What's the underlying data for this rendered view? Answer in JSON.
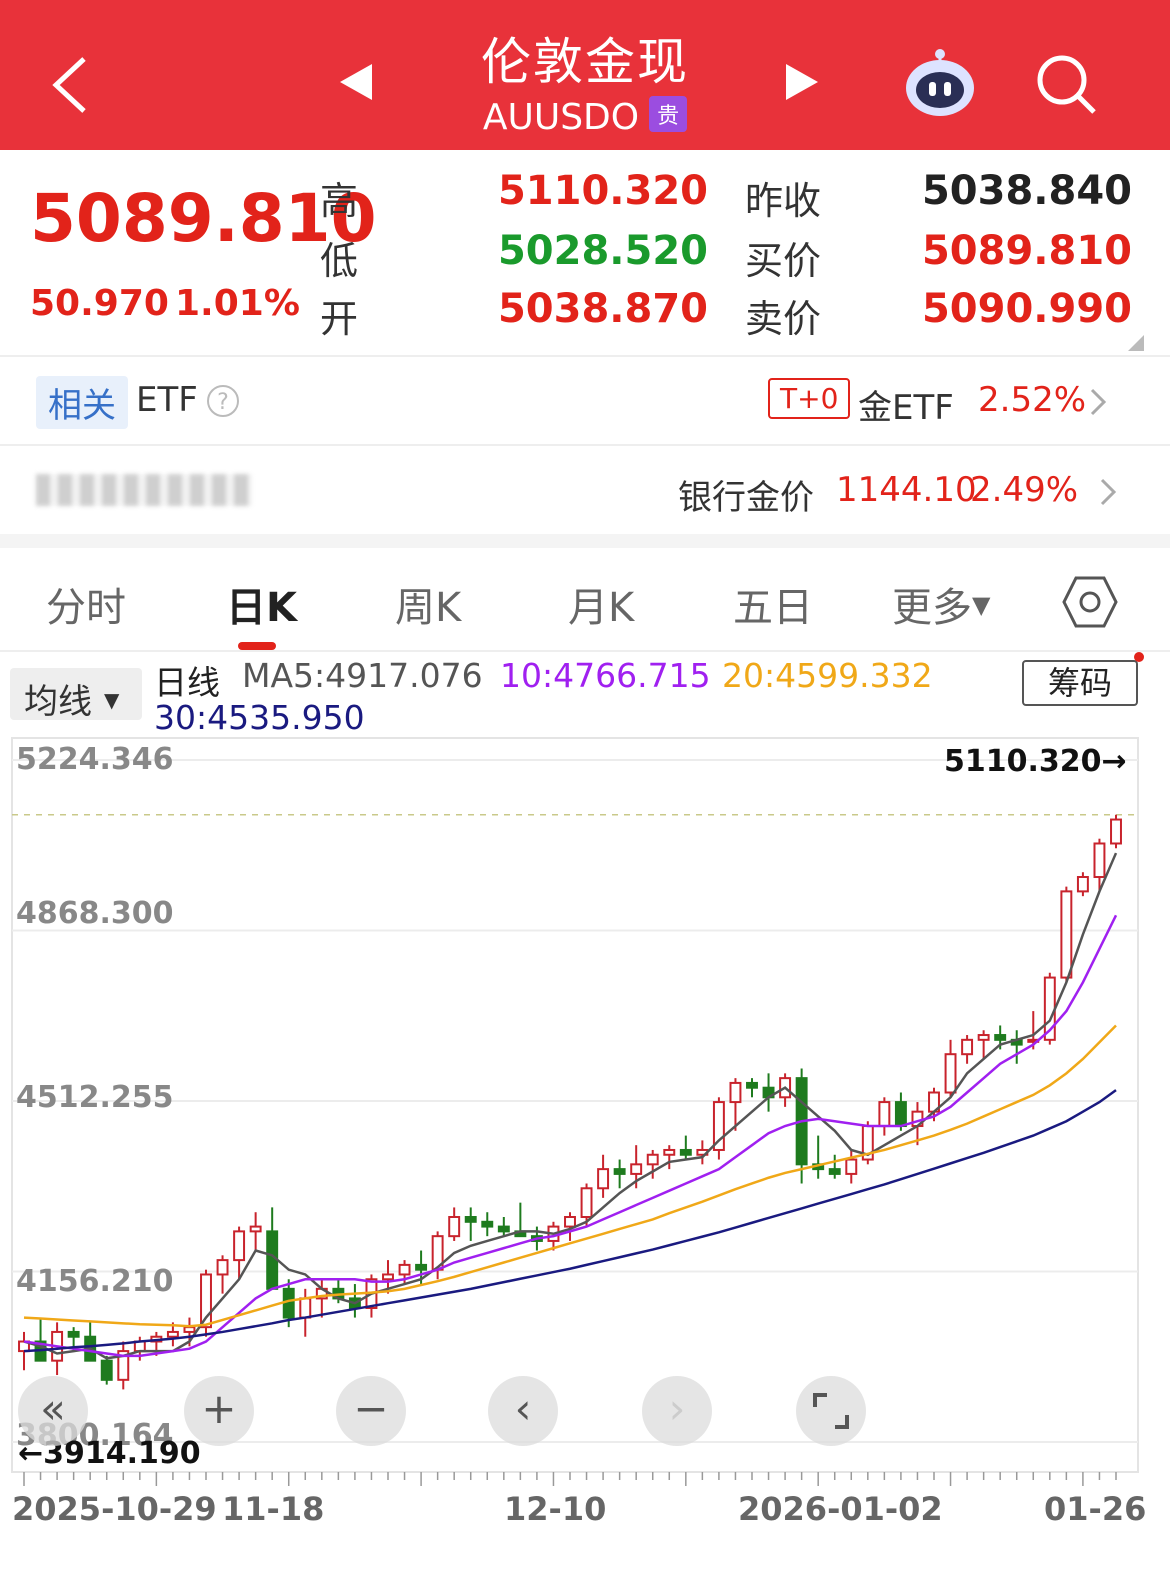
{
  "header": {
    "title": "伦敦金现",
    "code": "AUUSDO",
    "badge": "贵"
  },
  "quote": {
    "last": "5089.810",
    "change": "50.970",
    "change_pct": "1.01%",
    "high_label": "高",
    "high": "5110.320",
    "low_label": "低",
    "low": "5028.520",
    "open_label": "开",
    "open": "5038.870",
    "prev_label": "昨收",
    "prev": "5038.840",
    "bid_label": "买价",
    "bid": "5089.810",
    "ask_label": "卖价",
    "ask": "5090.990"
  },
  "etf_row": {
    "tag": "相关",
    "label": "ETF",
    "t0": "T+0",
    "name": "金ETF",
    "pct": "2.52%"
  },
  "bank_row": {
    "label": "银行金价",
    "price": "1144.10",
    "pct": "2.49%"
  },
  "tabs": [
    "分时",
    "日K",
    "周K",
    "月K",
    "五日",
    "更多"
  ],
  "ma_bar": {
    "select": "均线",
    "line_label": "日线",
    "ma5": "MA5:4917.076",
    "ma10": "10:4766.715",
    "ma20": "20:4599.332",
    "ma30": "30:4535.950",
    "chip_button": "筹码"
  },
  "colors": {
    "up": "#c8232c",
    "down": "#1e7b1e",
    "ma5": "#555555",
    "ma10": "#a020f0",
    "ma20": "#f0a818",
    "ma30": "#1a1a80",
    "header": "#e8323a"
  },
  "chart_data": {
    "type": "candlestick",
    "y_ticks": [
      "5224.346",
      "4868.300",
      "4512.255",
      "4156.210",
      "3800.164"
    ],
    "ylim": [
      3800.164,
      5224.346
    ],
    "x_ticks": [
      "2025-10-29",
      "11-18",
      "12-10",
      "2026-01-02",
      "01-26"
    ],
    "max_label": "5110.320→",
    "min_label": "←3914.190",
    "candles": [
      [
        3990,
        4030,
        3950,
        4010
      ],
      [
        4010,
        4060,
        3980,
        3970
      ],
      [
        3970,
        4050,
        3940,
        4030
      ],
      [
        4030,
        4040,
        3990,
        4020
      ],
      [
        4020,
        4050,
        3990,
        3970
      ],
      [
        3970,
        3980,
        3920,
        3930
      ],
      [
        3930,
        4010,
        3910,
        3990
      ],
      [
        3990,
        4020,
        3970,
        4010
      ],
      [
        4010,
        4030,
        3980,
        4020
      ],
      [
        4020,
        4050,
        4000,
        4030
      ],
      [
        4030,
        4060,
        4000,
        4040
      ],
      [
        4040,
        4160,
        4020,
        4150
      ],
      [
        4150,
        4190,
        4110,
        4180
      ],
      [
        4180,
        4250,
        4140,
        4240
      ],
      [
        4240,
        4280,
        4200,
        4250
      ],
      [
        4240,
        4290,
        4140,
        4120
      ],
      [
        4120,
        4140,
        4040,
        4060
      ],
      [
        4060,
        4120,
        4020,
        4100
      ],
      [
        4100,
        4140,
        4060,
        4120
      ],
      [
        4120,
        4140,
        4090,
        4100
      ],
      [
        4100,
        4130,
        4060,
        4080
      ],
      [
        4080,
        4150,
        4060,
        4140
      ],
      [
        4140,
        4180,
        4110,
        4150
      ],
      [
        4150,
        4180,
        4130,
        4170
      ],
      [
        4170,
        4200,
        4130,
        4160
      ],
      [
        4160,
        4240,
        4140,
        4230
      ],
      [
        4230,
        4290,
        4220,
        4270
      ],
      [
        4270,
        4290,
        4220,
        4260
      ],
      [
        4260,
        4280,
        4230,
        4250
      ],
      [
        4250,
        4270,
        4230,
        4240
      ],
      [
        4240,
        4300,
        4230,
        4230
      ],
      [
        4230,
        4250,
        4200,
        4220
      ],
      [
        4220,
        4260,
        4200,
        4250
      ],
      [
        4250,
        4280,
        4220,
        4270
      ],
      [
        4270,
        4340,
        4250,
        4330
      ],
      [
        4330,
        4400,
        4310,
        4370
      ],
      [
        4370,
        4390,
        4330,
        4360
      ],
      [
        4360,
        4420,
        4330,
        4380
      ],
      [
        4380,
        4410,
        4350,
        4400
      ],
      [
        4400,
        4420,
        4370,
        4410
      ],
      [
        4410,
        4440,
        4390,
        4400
      ],
      [
        4400,
        4430,
        4380,
        4410
      ],
      [
        4410,
        4520,
        4390,
        4510
      ],
      [
        4510,
        4560,
        4450,
        4550
      ],
      [
        4550,
        4560,
        4520,
        4540
      ],
      [
        4540,
        4570,
        4490,
        4520
      ],
      [
        4520,
        4570,
        4500,
        4560
      ],
      [
        4560,
        4580,
        4340,
        4380
      ],
      [
        4380,
        4440,
        4350,
        4370
      ],
      [
        4370,
        4400,
        4350,
        4360
      ],
      [
        4360,
        4410,
        4340,
        4390
      ],
      [
        4390,
        4470,
        4380,
        4460
      ],
      [
        4460,
        4520,
        4440,
        4510
      ],
      [
        4510,
        4530,
        4450,
        4460
      ],
      [
        4460,
        4510,
        4420,
        4490
      ],
      [
        4490,
        4540,
        4470,
        4530
      ],
      [
        4530,
        4640,
        4520,
        4610
      ],
      [
        4610,
        4650,
        4590,
        4640
      ],
      [
        4640,
        4660,
        4600,
        4650
      ],
      [
        4650,
        4670,
        4620,
        4640
      ],
      [
        4640,
        4660,
        4590,
        4630
      ],
      [
        4640,
        4700,
        4620,
        4640
      ],
      [
        4640,
        4780,
        4630,
        4770
      ],
      [
        4770,
        4960,
        4760,
        4950
      ],
      [
        4950,
        4990,
        4940,
        4980
      ],
      [
        4980,
        5060,
        4950,
        5050
      ],
      [
        5050,
        5110,
        5040,
        5100
      ]
    ],
    "ma5": [
      4010,
      4000,
      3985,
      3990,
      3995,
      3975,
      3980,
      3990,
      3990,
      3990,
      4010,
      4060,
      4100,
      4140,
      4200,
      4190,
      4160,
      4150,
      4120,
      4100,
      4090,
      4110,
      4120,
      4130,
      4140,
      4165,
      4195,
      4210,
      4220,
      4230,
      4240,
      4240,
      4235,
      4245,
      4260,
      4290,
      4320,
      4345,
      4365,
      4385,
      4390,
      4395,
      4430,
      4460,
      4490,
      4520,
      4540,
      4510,
      4480,
      4450,
      4410,
      4400,
      4420,
      4440,
      4460,
      4490,
      4520,
      4570,
      4600,
      4630,
      4640,
      4650,
      4680,
      4760,
      4860,
      4950,
      5030
    ],
    "ma10": [
      4010,
      4005,
      4000,
      3995,
      3990,
      3985,
      3980,
      3980,
      3985,
      3990,
      3995,
      4010,
      4040,
      4070,
      4100,
      4120,
      4130,
      4140,
      4140,
      4140,
      4140,
      4135,
      4135,
      4140,
      4150,
      4160,
      4175,
      4185,
      4195,
      4205,
      4215,
      4225,
      4230,
      4240,
      4250,
      4265,
      4280,
      4295,
      4310,
      4325,
      4340,
      4355,
      4370,
      4395,
      4420,
      4445,
      4460,
      4470,
      4475,
      4470,
      4465,
      4460,
      4460,
      4460,
      4470,
      4480,
      4500,
      4530,
      4560,
      4590,
      4610,
      4630,
      4660,
      4700,
      4760,
      4830,
      4900
    ],
    "ma20": [
      4060,
      4058,
      4056,
      4054,
      4052,
      4050,
      4048,
      4046,
      4045,
      4044,
      4042,
      4045,
      4055,
      4065,
      4075,
      4085,
      4095,
      4100,
      4105,
      4108,
      4110,
      4112,
      4115,
      4120,
      4128,
      4136,
      4145,
      4155,
      4165,
      4175,
      4185,
      4195,
      4205,
      4215,
      4225,
      4235,
      4245,
      4255,
      4265,
      4278,
      4290,
      4302,
      4315,
      4328,
      4340,
      4352,
      4362,
      4370,
      4378,
      4386,
      4394,
      4402,
      4410,
      4420,
      4430,
      4440,
      4452,
      4465,
      4480,
      4495,
      4510,
      4525,
      4545,
      4570,
      4600,
      4635,
      4670
    ],
    "ma30": [
      3990,
      3992,
      3995,
      3998,
      4000,
      4003,
      4006,
      4010,
      4013,
      4016,
      4020,
      4025,
      4030,
      4036,
      4042,
      4048,
      4055,
      4060,
      4066,
      4072,
      4078,
      4084,
      4090,
      4096,
      4102,
      4108,
      4114,
      4120,
      4127,
      4134,
      4141,
      4148,
      4155,
      4162,
      4170,
      4178,
      4186,
      4194,
      4202,
      4211,
      4220,
      4229,
      4238,
      4248,
      4258,
      4268,
      4278,
      4288,
      4298,
      4308,
      4318,
      4328,
      4338,
      4349,
      4360,
      4371,
      4382,
      4393,
      4404,
      4416,
      4428,
      4440,
      4455,
      4470,
      4490,
      4510,
      4535
    ]
  }
}
